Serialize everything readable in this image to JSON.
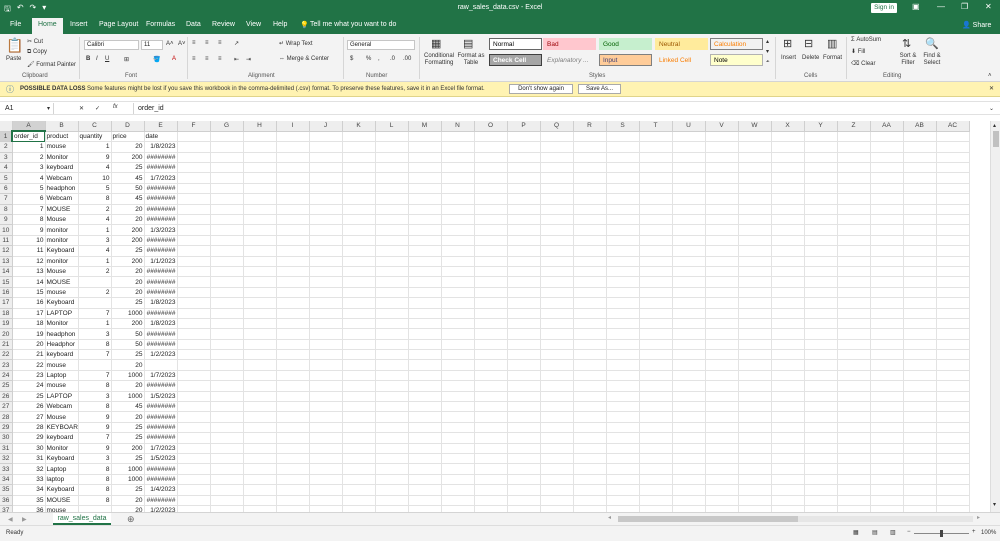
{
  "app": {
    "title": "raw_sales_data.csv - Excel",
    "sign_in": "Sign in",
    "share": "Share",
    "accent": "#217346"
  },
  "tabs": [
    "File",
    "Home",
    "Insert",
    "Page Layout",
    "Formulas",
    "Data",
    "Review",
    "View",
    "Help"
  ],
  "tell_me": "Tell me what you want to do",
  "ribbon": {
    "clipboard": {
      "paste": "Paste",
      "cut": "Cut",
      "copy": "Copy",
      "format_painter": "Format Painter",
      "group": "Clipboard"
    },
    "font": {
      "name": "Calibri",
      "size": "11",
      "group": "Font"
    },
    "alignment": {
      "wrap": "Wrap Text",
      "merge": "Merge & Center",
      "group": "Alignment"
    },
    "number": {
      "format": "General",
      "group": "Number"
    },
    "styles": {
      "conditional": "Conditional Formatting",
      "format_table": "Format as Table",
      "cells": [
        {
          "label": "Normal",
          "bg": "#ffffff",
          "fg": "#000000",
          "border": "#666666"
        },
        {
          "label": "Bad",
          "bg": "#ffc7ce",
          "fg": "#9c0006",
          "border": "#ffc7ce"
        },
        {
          "label": "Good",
          "bg": "#c6efce",
          "fg": "#006100",
          "border": "#c6efce"
        },
        {
          "label": "Neutral",
          "bg": "#ffeb9c",
          "fg": "#9c5700",
          "border": "#ffeb9c"
        },
        {
          "label": "Calculation",
          "bg": "#f2f2f2",
          "fg": "#fa7d00",
          "border": "#7f7f7f"
        },
        {
          "label": "Check Cell",
          "bg": "#a5a5a5",
          "fg": "#ffffff",
          "border": "#3f3f3f"
        },
        {
          "label": "Explanatory ...",
          "bg": "#f3f3f3",
          "fg": "#7f7f7f",
          "border": "#f3f3f3"
        },
        {
          "label": "Input",
          "bg": "#ffcc99",
          "fg": "#3f3f76",
          "border": "#7f7f7f"
        },
        {
          "label": "Linked Cell",
          "bg": "#f3f3f3",
          "fg": "#fa7d00",
          "border": "#f3f3f3"
        },
        {
          "label": "Note",
          "bg": "#ffffcc",
          "fg": "#000000",
          "border": "#b2b2b2"
        }
      ],
      "group": "Styles"
    },
    "cells": {
      "insert": "Insert",
      "delete": "Delete",
      "format": "Format",
      "group": "Cells"
    },
    "editing": {
      "autosum": "AutoSum",
      "fill": "Fill",
      "clear": "Clear",
      "sort": "Sort & Filter",
      "find": "Find & Select",
      "group": "Editing"
    }
  },
  "warning": {
    "title": "POSSIBLE DATA LOSS",
    "message": "Some features might be lost if you save this workbook in the comma-delimited (.csv) format. To preserve these features, save it in an Excel file format.",
    "dont_show": "Don't show again",
    "save_as": "Save As..."
  },
  "formula_bar": {
    "name_box": "A1",
    "content": "order_id"
  },
  "columns": [
    "A",
    "B",
    "C",
    "D",
    "E",
    "F",
    "G",
    "H",
    "I",
    "J",
    "K",
    "L",
    "M",
    "N",
    "O",
    "P",
    "Q",
    "R",
    "S",
    "T",
    "U",
    "V",
    "W",
    "X",
    "Y",
    "Z",
    "AA",
    "AB",
    "AC"
  ],
  "header_row": [
    "order_id",
    "product",
    "quantity",
    "price",
    "date"
  ],
  "rows": [
    [
      "1",
      "mouse",
      "1",
      "20",
      "1/8/2023"
    ],
    [
      "2",
      "Monitor",
      "9",
      "200",
      "########"
    ],
    [
      "3",
      "keyboard",
      "4",
      "25",
      "########"
    ],
    [
      "4",
      "Webcam",
      "10",
      "45",
      "1/7/2023"
    ],
    [
      "5",
      "headphon",
      "5",
      "50",
      "########"
    ],
    [
      "6",
      "Webcam",
      "8",
      "45",
      "########"
    ],
    [
      "7",
      "MOUSE",
      "2",
      "20",
      "########"
    ],
    [
      "8",
      "Mouse",
      "4",
      "20",
      "########"
    ],
    [
      "9",
      "monitor",
      "1",
      "200",
      "1/3/2023"
    ],
    [
      "10",
      "monitor",
      "3",
      "200",
      "########"
    ],
    [
      "11",
      "Keyboard",
      "4",
      "25",
      "########"
    ],
    [
      "12",
      "monitor",
      "1",
      "200",
      "1/1/2023"
    ],
    [
      "13",
      "Mouse",
      "2",
      "20",
      "########"
    ],
    [
      "14",
      "MOUSE",
      "",
      "20",
      "########"
    ],
    [
      "15",
      "mouse",
      "2",
      "20",
      "########"
    ],
    [
      "16",
      "Keyboard",
      "",
      "25",
      "1/8/2023"
    ],
    [
      "17",
      "LAPTOP",
      "7",
      "1000",
      "########"
    ],
    [
      "18",
      "Monitor",
      "1",
      "200",
      "1/8/2023"
    ],
    [
      "19",
      "headphon",
      "3",
      "50",
      "########"
    ],
    [
      "20",
      "Headphor",
      "8",
      "50",
      "########"
    ],
    [
      "21",
      "keyboard",
      "7",
      "25",
      "1/2/2023"
    ],
    [
      "22",
      "mouse",
      "",
      "20",
      ""
    ],
    [
      "23",
      "Laptop",
      "7",
      "1000",
      "1/7/2023"
    ],
    [
      "24",
      "mouse",
      "8",
      "20",
      "########"
    ],
    [
      "25",
      "LAPTOP",
      "3",
      "1000",
      "1/5/2023"
    ],
    [
      "26",
      "Webcam",
      "8",
      "45",
      "########"
    ],
    [
      "27",
      "Mouse",
      "9",
      "20",
      "########"
    ],
    [
      "28",
      "KEYBOARI",
      "9",
      "25",
      "########"
    ],
    [
      "29",
      "keyboard",
      "7",
      "25",
      "########"
    ],
    [
      "30",
      "Monitor",
      "9",
      "200",
      "1/7/2023"
    ],
    [
      "31",
      "Keyboard",
      "3",
      "25",
      "1/5/2023"
    ],
    [
      "32",
      "Laptop",
      "8",
      "1000",
      "########"
    ],
    [
      "33",
      "laptop",
      "8",
      "1000",
      "########"
    ],
    [
      "34",
      "Keyboard",
      "8",
      "25",
      "1/4/2023"
    ],
    [
      "35",
      "MOUSE",
      "8",
      "20",
      "########"
    ],
    [
      "36",
      "mouse",
      "",
      "20",
      "1/2/2023"
    ]
  ],
  "sheet_tab": "raw_sales_data",
  "status": {
    "ready": "Ready",
    "zoom": "100%"
  }
}
